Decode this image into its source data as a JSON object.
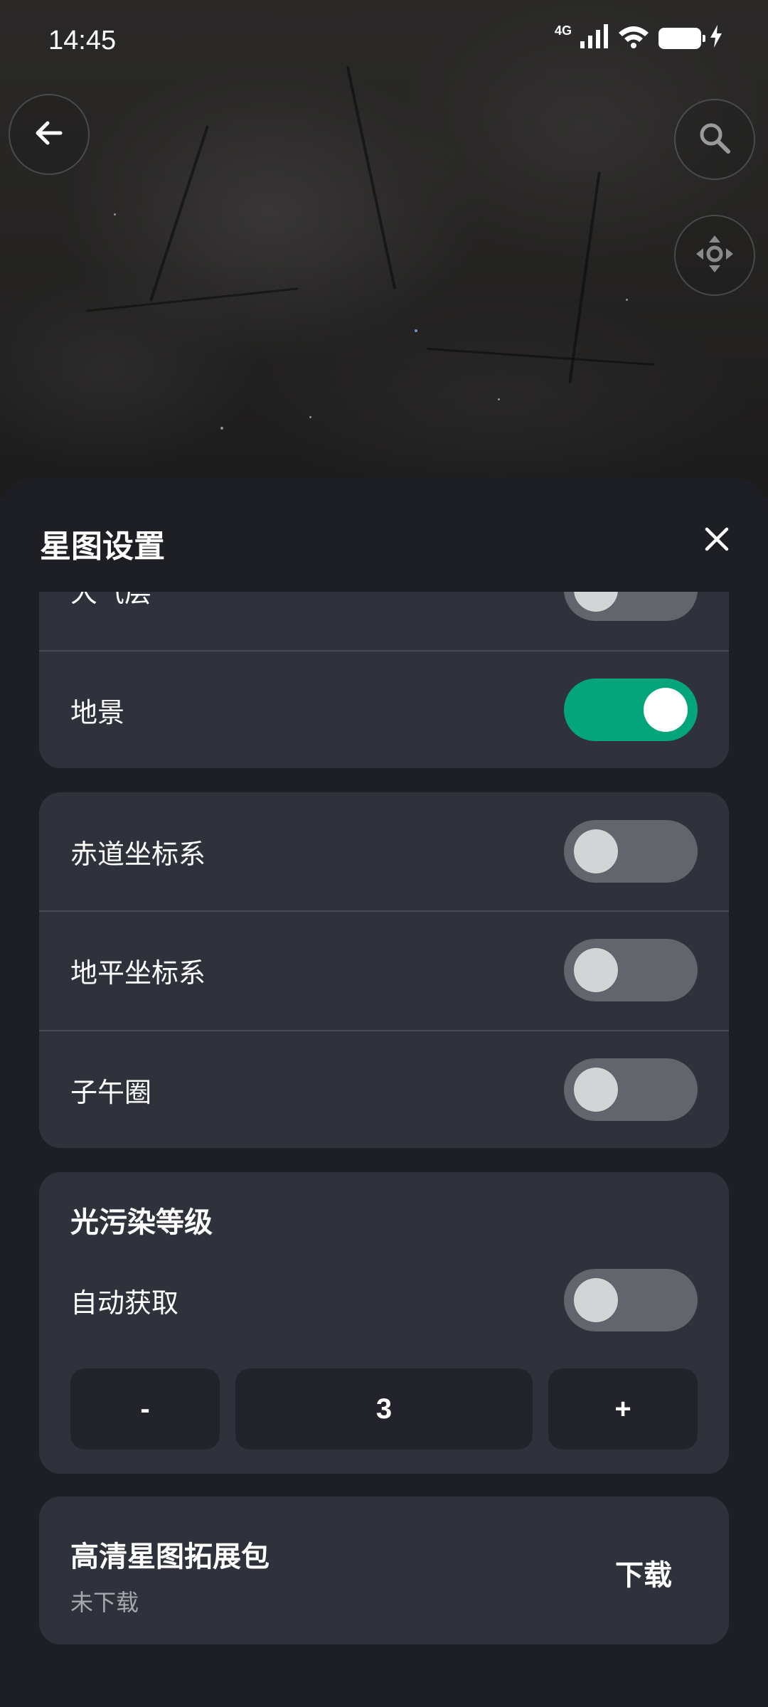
{
  "status_bar": {
    "time": "14:45",
    "network": "4G"
  },
  "sheet": {
    "title": "星图设置"
  },
  "display_card": {
    "rows": [
      {
        "label": "大气层",
        "enabled": false
      },
      {
        "label": "地景",
        "enabled": true
      }
    ]
  },
  "coords_card": {
    "rows": [
      {
        "label": "赤道坐标系",
        "enabled": false
      },
      {
        "label": "地平坐标系",
        "enabled": false
      },
      {
        "label": "子午圈",
        "enabled": false
      }
    ]
  },
  "light_pollution": {
    "title": "光污染等级",
    "auto_label": "自动获取",
    "auto_enabled": false,
    "decrement_label": "-",
    "value": "3",
    "increment_label": "+"
  },
  "hd_pack": {
    "title": "高清星图拓展包",
    "status": "未下载",
    "action_label": "下载"
  },
  "colors": {
    "accent_toggle_on": "#05a57b",
    "card_bg": "#30323b",
    "sheet_bg": "#1e1f24"
  },
  "icons": {
    "back": "arrow-left-icon",
    "search": "search-icon",
    "recenter": "recenter-icon",
    "close": "close-icon"
  }
}
